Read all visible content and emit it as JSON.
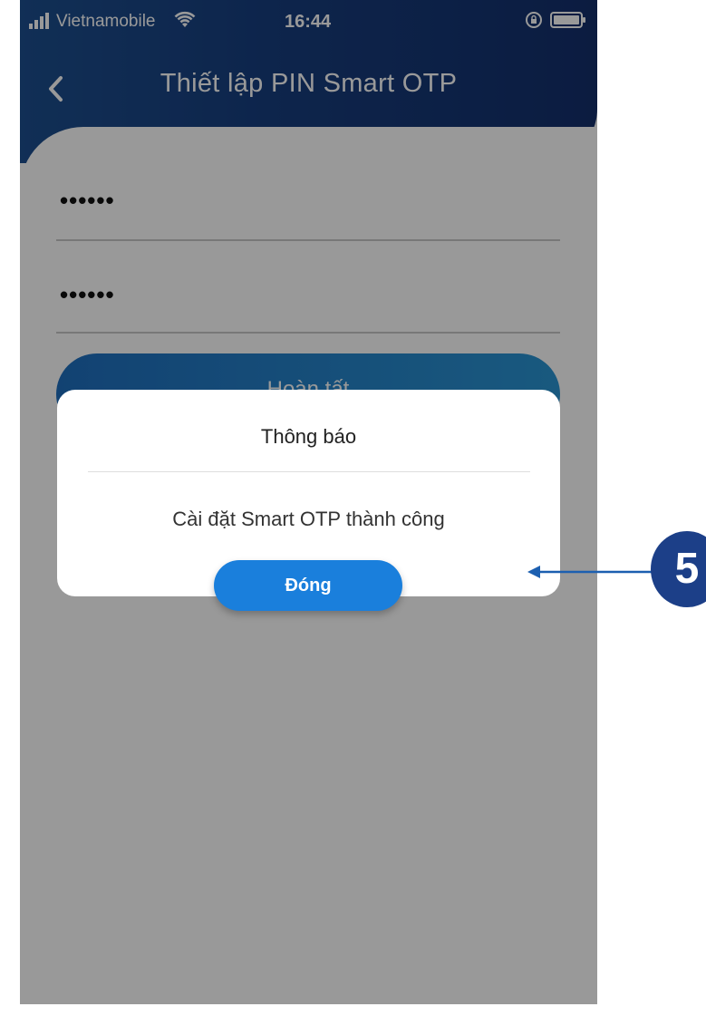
{
  "status_bar": {
    "carrier": "Vietnamobile",
    "time": "16:44",
    "signal_icon": "signal-bars-icon",
    "wifi_icon": "wifi-icon",
    "rotation_icon": "rotation-lock-icon",
    "battery_icon": "battery-icon"
  },
  "header": {
    "title": "Thiết lập PIN Smart OTP",
    "back_icon": "chevron-left-icon",
    "color_start": "#1d4f8f",
    "color_end": "#142f6c"
  },
  "form": {
    "pin_value": "••••••",
    "confirm_pin_value": "••••••",
    "complete_label": "Hoàn tất"
  },
  "modal": {
    "title": "Thông báo",
    "message": "Cài đặt Smart OTP thành công",
    "close_label": "Đóng",
    "button_color": "#1a7fdc"
  },
  "annotation": {
    "step_number": "5",
    "badge_color": "#1c3f88"
  }
}
